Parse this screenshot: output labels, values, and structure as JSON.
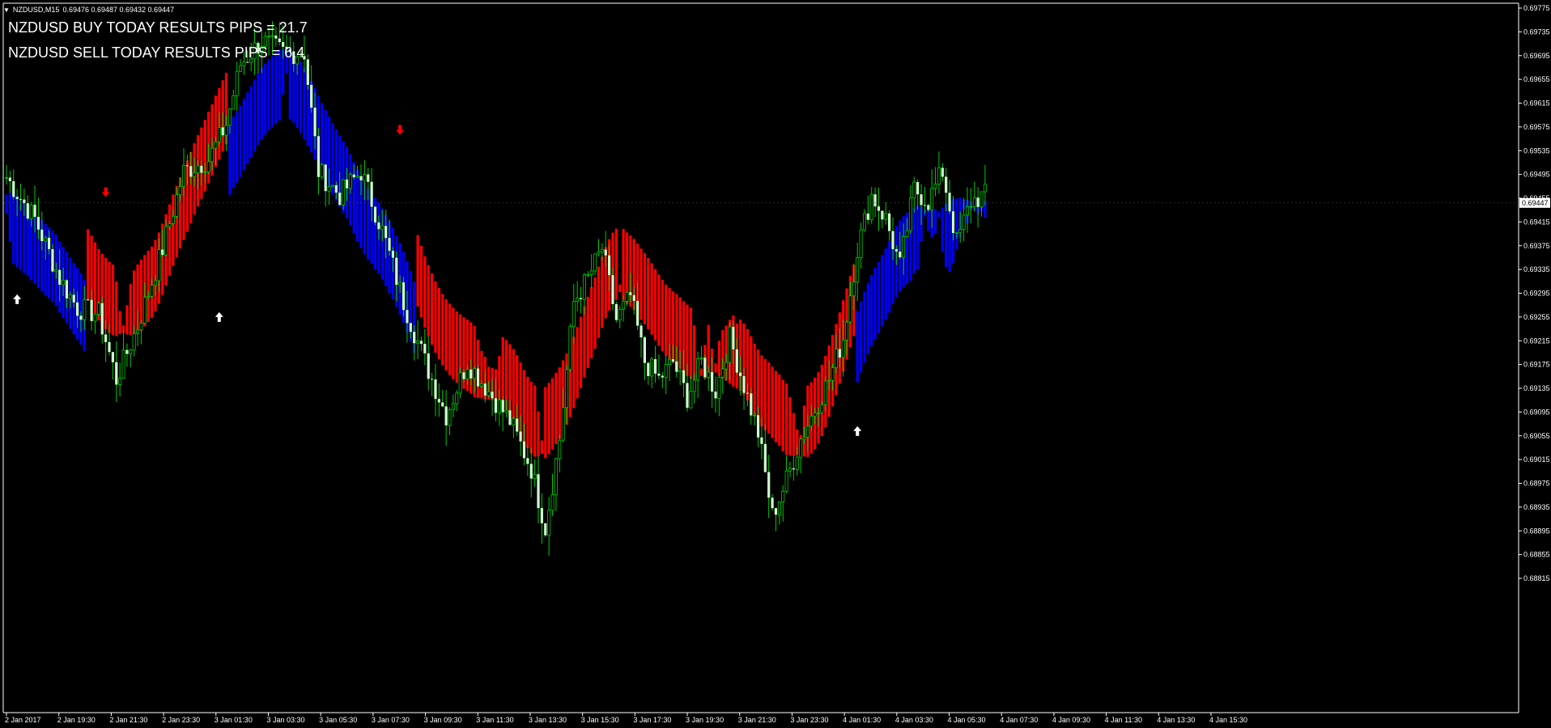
{
  "window": {
    "symbol_caption": "NZDUSD,M15",
    "ohlc_values": "0.69476 0.69487 0.69432 0.69447",
    "menu_icon": "triangle-down-icon"
  },
  "results": {
    "buy_text": "NZDUSD BUY TODAY RESULTS PIPS = 21.7",
    "sell_text": "NZDUSD SELL TODAY RESULTS PIPS = 6.4"
  },
  "colors": {
    "background": "#000000",
    "candle_bull": "#ccffcc",
    "candle_wick": "#00cc00",
    "band_up": "#0000ff",
    "band_down": "#ff0000",
    "arrow_buy": "#ffffff",
    "arrow_sell": "#ff0000",
    "axis": "#ffffff"
  },
  "chart_data": {
    "type": "candlestick",
    "symbol": "NZDUSD",
    "timeframe": "M15",
    "current_price": "0.69447",
    "y_ticks": [
      "0.69775",
      "0.69735",
      "0.69695",
      "0.69655",
      "0.69615",
      "0.69575",
      "0.69535",
      "0.69495",
      "0.69455",
      "0.69415",
      "0.69375",
      "0.69335",
      "0.69295",
      "0.69255",
      "0.69215",
      "0.69175",
      "0.69135",
      "0.69095",
      "0.69055",
      "0.69015",
      "0.68975",
      "0.68935",
      "0.68895",
      "0.68855",
      "0.68815"
    ],
    "x_ticks": [
      "2 Jan 2017",
      "2 Jan 19:30",
      "2 Jan 21:30",
      "2 Jan 23:30",
      "3 Jan 01:30",
      "3 Jan 03:30",
      "3 Jan 05:30",
      "3 Jan 07:30",
      "3 Jan 09:30",
      "3 Jan 11:30",
      "3 Jan 13:30",
      "3 Jan 15:30",
      "3 Jan 17:30",
      "3 Jan 19:30",
      "3 Jan 21:30",
      "3 Jan 23:30",
      "4 Jan 01:30",
      "4 Jan 03:30",
      "4 Jan 05:30",
      "4 Jan 07:30",
      "4 Jan 09:30",
      "4 Jan 11:30",
      "4 Jan 13:30",
      "4 Jan 15:30"
    ],
    "ylim": [
      0.68815,
      0.69775
    ],
    "price_path": [
      [
        0,
        0.6949
      ],
      [
        8,
        0.6942
      ],
      [
        15,
        0.6932
      ],
      [
        20,
        0.6927
      ],
      [
        26,
        0.6926
      ],
      [
        31,
        0.6915
      ],
      [
        37,
        0.6924
      ],
      [
        44,
        0.6937
      ],
      [
        50,
        0.695
      ],
      [
        57,
        0.6952
      ],
      [
        62,
        0.6958
      ],
      [
        66,
        0.6968
      ],
      [
        72,
        0.6972
      ],
      [
        78,
        0.697
      ],
      [
        84,
        0.697
      ],
      [
        88,
        0.695
      ],
      [
        94,
        0.6946
      ],
      [
        100,
        0.695
      ],
      [
        106,
        0.694
      ],
      [
        112,
        0.6928
      ],
      [
        118,
        0.6918
      ],
      [
        124,
        0.6909
      ],
      [
        130,
        0.6918
      ],
      [
        136,
        0.6913
      ],
      [
        142,
        0.6908
      ],
      [
        148,
        0.69
      ],
      [
        152,
        0.689
      ],
      [
        156,
        0.6905
      ],
      [
        160,
        0.6928
      ],
      [
        164,
        0.6932
      ],
      [
        168,
        0.6937
      ],
      [
        172,
        0.6925
      ],
      [
        176,
        0.6929
      ],
      [
        180,
        0.6918
      ],
      [
        184,
        0.6915
      ],
      [
        188,
        0.6918
      ],
      [
        192,
        0.6912
      ],
      [
        196,
        0.6918
      ],
      [
        200,
        0.6913
      ],
      [
        204,
        0.6922
      ],
      [
        208,
        0.6914
      ],
      [
        212,
        0.6906
      ],
      [
        216,
        0.6892
      ],
      [
        220,
        0.6898
      ],
      [
        224,
        0.6905
      ],
      [
        228,
        0.691
      ],
      [
        232,
        0.6915
      ],
      [
        236,
        0.6922
      ],
      [
        240,
        0.6937
      ],
      [
        244,
        0.6946
      ],
      [
        248,
        0.6942
      ],
      [
        252,
        0.6934
      ],
      [
        256,
        0.6947
      ],
      [
        260,
        0.6945
      ],
      [
        264,
        0.695
      ],
      [
        268,
        0.6938
      ],
      [
        272,
        0.6945
      ],
      [
        276,
        0.6946
      ]
    ],
    "band": {
      "segments": [
        {
          "color": "up",
          "from": 0,
          "to": 22
        },
        {
          "color": "down",
          "from": 23,
          "to": 62
        },
        {
          "color": "up",
          "from": 62,
          "to": 115
        },
        {
          "color": "down",
          "from": 116,
          "to": 239
        },
        {
          "color": "up",
          "from": 240,
          "to": 276
        }
      ]
    },
    "signals": [
      {
        "type": "buy",
        "bar": 3,
        "price": 0.69285
      },
      {
        "type": "sell",
        "bar": 28,
        "price": 0.69465
      },
      {
        "type": "buy",
        "bar": 60,
        "price": 0.69255
      },
      {
        "type": "sell",
        "bar": 111,
        "price": 0.6957
      },
      {
        "type": "buy",
        "bar": 240,
        "price": 0.69063
      }
    ]
  }
}
